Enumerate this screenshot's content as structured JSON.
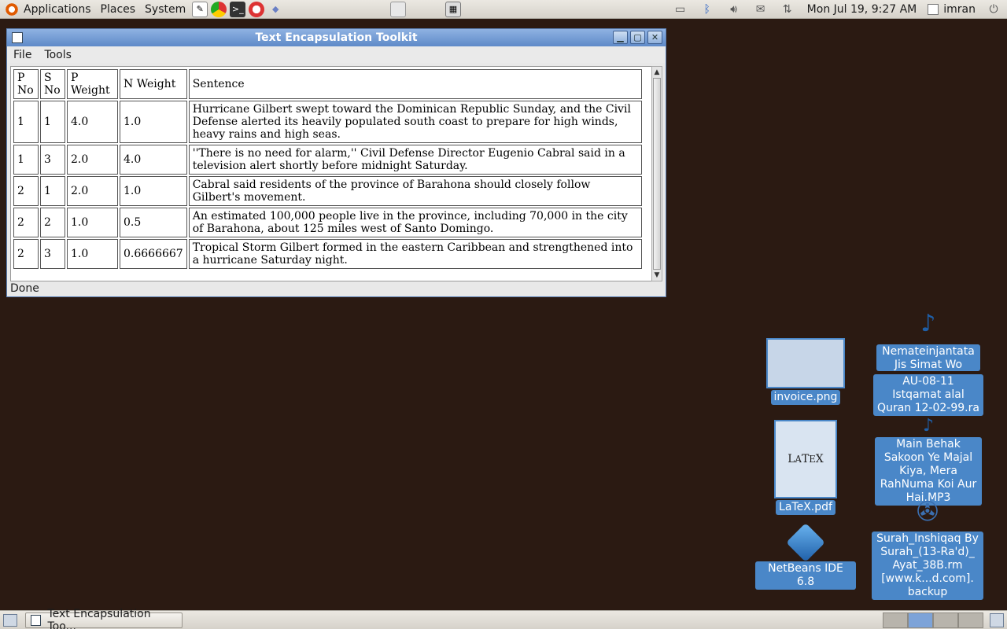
{
  "top_panel": {
    "menus": [
      "Applications",
      "Places",
      "System"
    ],
    "clock": "Mon Jul 19,  9:27 AM",
    "user": "imran",
    "launcher_icons": [
      "text-editor-icon",
      "chrome-icon",
      "terminal-icon",
      "help-icon",
      "app-icon"
    ],
    "tray_icons": [
      "files-icon",
      "bluetooth-icon",
      "volume-icon",
      "mail-icon",
      "network-icon"
    ]
  },
  "window": {
    "title": "Text Encapsulation Toolkit",
    "menu": [
      "File",
      "Tools"
    ],
    "status": "Done",
    "table": {
      "headers": [
        "P\nNo",
        "S\nNo",
        "P\nWeight",
        "N Weight",
        "Sentence"
      ],
      "rows": [
        [
          "1",
          "1",
          "4.0",
          "1.0",
          "Hurricane Gilbert swept toward the Dominican Republic Sunday, and the Civil Defense alerted its heavily populated south coast to prepare for high winds, heavy rains and high seas."
        ],
        [
          "1",
          "3",
          "2.0",
          "4.0",
          "''There is no need for alarm,'' Civil Defense Director Eugenio Cabral said in a television alert shortly before midnight Saturday."
        ],
        [
          "2",
          "1",
          "2.0",
          "1.0",
          "Cabral said residents of the province of Barahona should closely follow Gilbert's movement."
        ],
        [
          "2",
          "2",
          "1.0",
          "0.5",
          "An estimated 100,000 people live in the province, including 70,000 in the city of Barahona, about 125 miles west of Santo Domingo."
        ],
        [
          "2",
          "3",
          "1.0",
          "0.6666667",
          "Tropical Storm Gilbert formed in the eastern Caribbean and strengthened into a hurricane Saturday night."
        ]
      ]
    }
  },
  "desktop": {
    "invoice": "invoice.png",
    "latex": "LaTeX.pdf",
    "netbeans": "NetBeans IDE 6.8",
    "nemtein": "Nemateinjantata Jis Simat Wo",
    "au": "AU-08-11 Istqamat alal Quran 12-02-99.ra",
    "main": "Main Behak Sakoon Ye Majal Kiya, Mera RahNuma Koi Aur Hai.MP3",
    "surah": "Surah_Inshiqaq By Surah_(13-Ra'd)_ Ayat_38B.rm [www.k...d.com]. backup"
  },
  "bottom_panel": {
    "task": "Text Encapsulation Too..."
  }
}
